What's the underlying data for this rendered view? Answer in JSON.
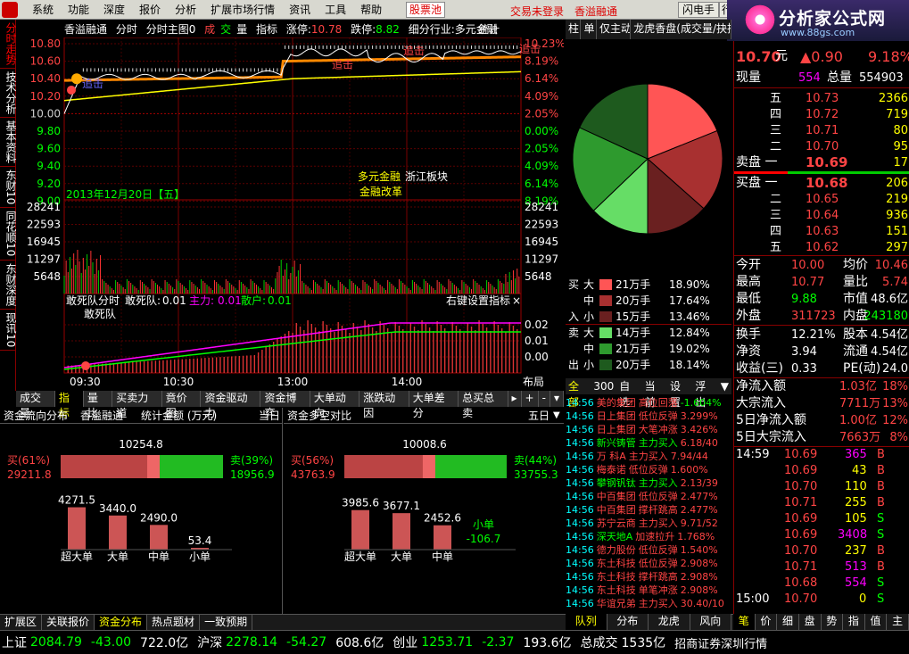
{
  "menu": {
    "items": [
      "系统",
      "功能",
      "深度",
      "报价",
      "分析",
      "扩展市场行情",
      "资讯",
      "工具",
      "帮助"
    ],
    "stock_pool": "股票池",
    "not_logged": "交易未登录",
    "stock_name": "香溢融通",
    "flash": "闪电手",
    "more": "行"
  },
  "brand": {
    "title": "分析家公式网",
    "url": "www.88gs.com",
    "sub": "88gs.com"
  },
  "left_tabs": [
    "分时走势",
    "技术分析",
    "基本资料",
    "东财10",
    "同花顺10",
    "东财深度",
    "现讯10"
  ],
  "chart": {
    "title": {
      "name": "香溢融通",
      "mode1": "分时",
      "mode2": "分时主图0",
      "v_red": "成",
      "v_green": "交",
      "v_tail": "量",
      "ind": "指标",
      "rise": "涨停:",
      "rise_val": "10.78",
      "fall": "跌停:",
      "fall_val": "8.82",
      "industry": "细分行业:多元金融",
      "stat": "统计"
    },
    "price_left": [
      "10.80",
      "10.60",
      "10.40",
      "10.20",
      "10.00",
      "9.80",
      "9.60",
      "9.40",
      "9.20",
      "9.00"
    ],
    "price_right": [
      "10.23%",
      "8.19%",
      "6.14%",
      "4.09%",
      "2.05%",
      "0.00%",
      "2.05%",
      "4.09%",
      "6.14%",
      "8.19%"
    ],
    "vol_ticks": [
      "28241",
      "22593",
      "16945",
      "11297",
      "5648"
    ],
    "date_label": "2013年12月20日【五】",
    "tag1": "多元金融",
    "tag2": "浙江板块",
    "tag3": "金融改革",
    "marker_text": "追击",
    "lower": {
      "name": "敢死队分时",
      "g_lab": "敢死队:",
      "g_val": "0.01",
      "zl_lab": "主力:",
      "zl_val": "0.01",
      "sh_lab": "散户:",
      "sh_val": "0.01",
      "hint": "右键设置指标",
      "sub": "敢死队",
      "ticks": [
        "0.02",
        "0.01",
        "0.00"
      ]
    },
    "time_labels": [
      "09:30",
      "10:30",
      "13:00",
      "14:00"
    ],
    "layout_btn": "布局"
  },
  "bottom_tabs": [
    "成交量",
    "指标",
    "量比",
    "买卖力道",
    "竟价图",
    "资金驱动力",
    "资金博弈",
    "大单动向",
    "涨跌动因",
    "大单差分",
    "总买总卖"
  ],
  "flow": {
    "title": "资金流向分布",
    "stock": "香溢融通",
    "stat": "统计金额 (万元)",
    "period": "当日",
    "total": "10254.8",
    "buy_lab": "买(61%)",
    "buy_val": "29211.8",
    "sell_lab": "卖(39%)",
    "sell_val": "18956.9",
    "bars": [
      {
        "name": "超大单",
        "val": "4271.5"
      },
      {
        "name": "大单",
        "val": "3440.0"
      },
      {
        "name": "中单",
        "val": "2490.0"
      },
      {
        "name": "小单",
        "val": "53.4"
      }
    ]
  },
  "duikong": {
    "title": "资金多空对比",
    "period": "五日",
    "total": "10008.6",
    "buy_lab": "买(56%)",
    "buy_val": "43763.9",
    "sell_lab": "卖(44%)",
    "sell_val": "33755.3",
    "bars": [
      {
        "name": "超大单",
        "val": "3985.6"
      },
      {
        "name": "大单",
        "val": "3677.1"
      },
      {
        "name": "中单",
        "val": "2452.6"
      },
      {
        "name": "小单",
        "val": "-106.7"
      }
    ]
  },
  "bottom_bar": [
    "扩展区",
    "关联报价",
    "资金分布",
    "热点题材",
    "一致预期"
  ],
  "status": {
    "sh": "上证",
    "sh_v": "2084.79",
    "sh_c": "-43.00",
    "sh_a": "722.0亿",
    "sz": "沪深",
    "sz_v": "2278.14",
    "sz_c": "-54.27",
    "sz_a": "608.6亿",
    "cy": "创业",
    "cy_v": "1253.71",
    "cy_c": "-2.37",
    "cy_a": "193.6亿",
    "tot": "总成交",
    "tot_v": "1535亿",
    "broker": "招商证券深圳行情"
  },
  "right_tabs": [
    "柱",
    "单",
    "仅主动",
    "龙虎香盘(成交量/抉择)"
  ],
  "pie": {
    "rows": [
      {
        "side": "买",
        "lev": "大",
        "vol": "21万手",
        "pct": "18.90%"
      },
      {
        "side": "",
        "lev": "中",
        "vol": "20万手",
        "pct": "17.64%"
      },
      {
        "side": "入",
        "lev": "小",
        "vol": "15万手",
        "pct": "13.46%"
      },
      {
        "side": "卖",
        "lev": "大",
        "vol": "14万手",
        "pct": "12.84%"
      },
      {
        "side": "",
        "lev": "中",
        "vol": "21万手",
        "pct": "19.02%"
      },
      {
        "side": "出",
        "lev": "小",
        "vol": "20万手",
        "pct": "18.14%"
      }
    ],
    "colors": [
      "#ff5555",
      "#a83030",
      "#6a2020",
      "#66dd66",
      "#2e9a2e",
      "#1e5a1e"
    ],
    "values": [
      18.9,
      17.64,
      13.46,
      12.84,
      19.02,
      18.14
    ]
  },
  "news_tabs": [
    "全部",
    "300",
    "自选",
    "当前",
    "设置",
    "浮出"
  ],
  "news": [
    [
      "14:56",
      "美的集团",
      "高位回落",
      "-1.604%"
    ],
    [
      "14:56",
      "日上集团",
      "低位反弹",
      "3.299%"
    ],
    [
      "14:56",
      "日上集团",
      "大笔冲涨",
      "3.426%"
    ],
    [
      "14:56",
      "新兴铸管",
      "主力买入",
      "6.18/40"
    ],
    [
      "14:56",
      "万 科A",
      "主力买入",
      "7.94/44"
    ],
    [
      "14:56",
      "梅泰诺",
      "低位反弹",
      "1.600%"
    ],
    [
      "14:56",
      "攀钢钒钛",
      "主力买入",
      "2.13/39"
    ],
    [
      "14:56",
      "中百集团",
      "低位反弹",
      "2.477%"
    ],
    [
      "14:56",
      "中百集团",
      "撑杆跳高",
      "2.477%"
    ],
    [
      "14:56",
      "苏宁云商",
      "主力买入",
      "9.71/52"
    ],
    [
      "14:56",
      "深天地A",
      "加速拉升",
      "1.768%"
    ],
    [
      "14:56",
      "德力股份",
      "低位反弹",
      "1.540%"
    ],
    [
      "14:56",
      "东土科技",
      "低位反弹",
      "2.908%"
    ],
    [
      "14:56",
      "东土科技",
      "撑杆跳高",
      "2.908%"
    ],
    [
      "14:56",
      "东土科技",
      "单笔冲涨",
      "2.908%"
    ],
    [
      "14:56",
      "华谊兄弟",
      "主力买入",
      "30.40/10"
    ]
  ],
  "nav_bottom": [
    "队列",
    "分布",
    "龙虎",
    "风向"
  ],
  "quote": {
    "price": "10.70",
    "unit": "元",
    "chg": "▲0.90",
    "pct": "9.18%",
    "now_lab": "现量",
    "now_val": "554",
    "tot_lab": "总量",
    "tot_val": "554903",
    "sell": [
      {
        "lab": "五",
        "p": "10.73",
        "v": "2366"
      },
      {
        "lab": "四",
        "p": "10.72",
        "v": "719"
      },
      {
        "lab": "三",
        "p": "10.71",
        "v": "80"
      },
      {
        "lab": "二",
        "p": "10.70",
        "v": "95"
      },
      {
        "lab": "卖盘 一",
        "p": "10.69",
        "v": "17"
      }
    ],
    "buy": [
      {
        "lab": "买盘 一",
        "p": "10.68",
        "v": "206"
      },
      {
        "lab": "二",
        "p": "10.65",
        "v": "219"
      },
      {
        "lab": "三",
        "p": "10.64",
        "v": "936"
      },
      {
        "lab": "四",
        "p": "10.63",
        "v": "151"
      },
      {
        "lab": "五",
        "p": "10.62",
        "v": "297"
      }
    ],
    "stats": [
      [
        "今开",
        "10.00",
        "均价",
        "10.46"
      ],
      [
        "最高",
        "10.77",
        "量比",
        "5.74"
      ],
      [
        "最低",
        "9.88",
        "市值",
        "48.6亿"
      ],
      [
        "外盘",
        "311723",
        "内盘",
        "243180"
      ]
    ],
    "stats2": [
      [
        "换手",
        "12.21%",
        "股本",
        "4.54亿"
      ],
      [
        "净资",
        "3.94",
        "流通",
        "4.54亿"
      ],
      [
        "收益(三)",
        "0.33",
        "PE(动)",
        "24.0"
      ]
    ],
    "flow": [
      [
        "净流入额",
        "1.03亿",
        "18%"
      ],
      [
        "大宗流入",
        "7711万",
        "13%"
      ],
      [
        "5日净流入额",
        "1.00亿",
        "12%"
      ],
      [
        "5日大宗流入",
        "7663万",
        "8%"
      ]
    ],
    "ticks": [
      [
        "14:59",
        "10.69",
        "365",
        "B"
      ],
      [
        "",
        "10.69",
        "43",
        "B"
      ],
      [
        "",
        "10.70",
        "110",
        "B"
      ],
      [
        "",
        "10.71",
        "255",
        "B"
      ],
      [
        "",
        "10.69",
        "105",
        "S"
      ],
      [
        "",
        "10.69",
        "3408",
        "S"
      ],
      [
        "",
        "10.70",
        "237",
        "B"
      ],
      [
        "",
        "10.71",
        "513",
        "B"
      ],
      [
        "",
        "10.68",
        "554",
        "S"
      ],
      [
        "15:00",
        "10.70",
        "0",
        "S"
      ]
    ]
  },
  "quote_tabs": [
    "笔",
    "价",
    "细",
    "盘",
    "势",
    "指",
    "值",
    "主"
  ]
}
